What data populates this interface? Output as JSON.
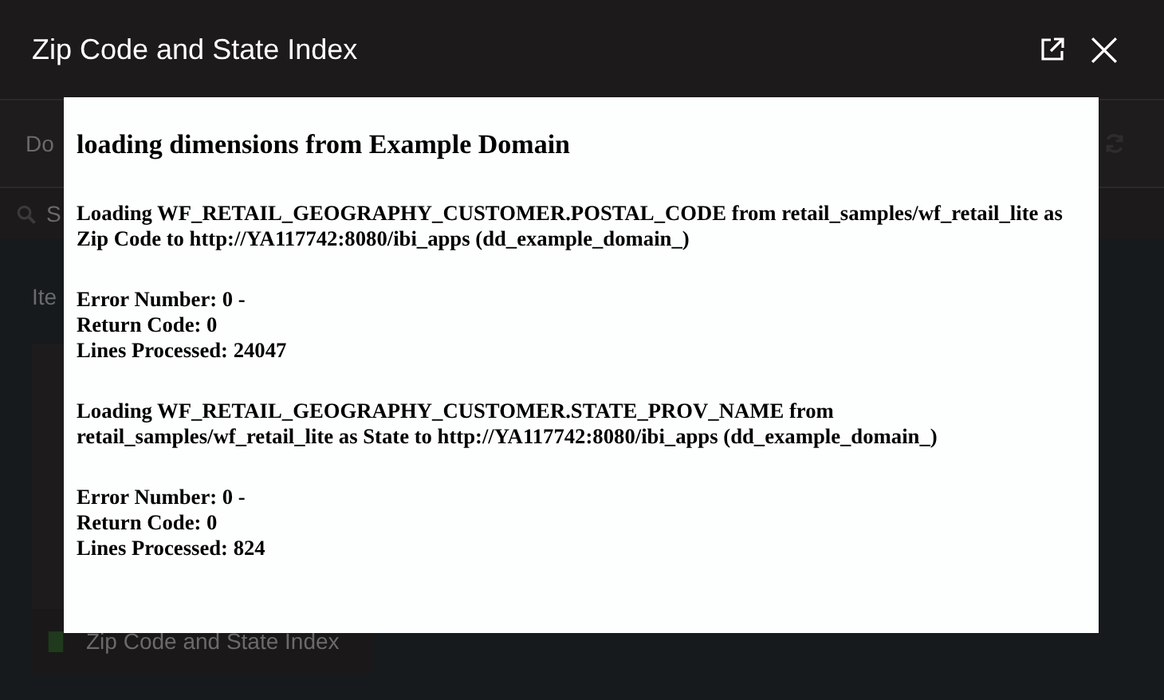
{
  "background": {
    "toolbar_text": "Do",
    "search_text": "S",
    "section_label": "Ite",
    "list_items": [
      {
        "label": "Zip Code and State Index"
      }
    ]
  },
  "dialog": {
    "title": "Zip Code and State Index",
    "heading": "loading dimensions from Example Domain",
    "blocks": [
      {
        "lines": [
          "Loading WF_RETAIL_GEOGRAPHY_CUSTOMER.POSTAL_CODE from retail_samples/wf_retail_lite as Zip Code to http://YA117742:8080/ibi_apps (dd_example_domain_)"
        ]
      },
      {
        "lines": [
          "Error Number: 0 -",
          "Return Code: 0",
          "Lines Processed: 24047"
        ]
      },
      {
        "lines": [
          "Loading WF_RETAIL_GEOGRAPHY_CUSTOMER.STATE_PROV_NAME from retail_samples/wf_retail_lite as State to http://YA117742:8080/ibi_apps (dd_example_domain_)"
        ]
      },
      {
        "lines": [
          "Error Number: 0 -",
          "Return Code: 0",
          "Lines Processed: 824"
        ]
      }
    ]
  }
}
